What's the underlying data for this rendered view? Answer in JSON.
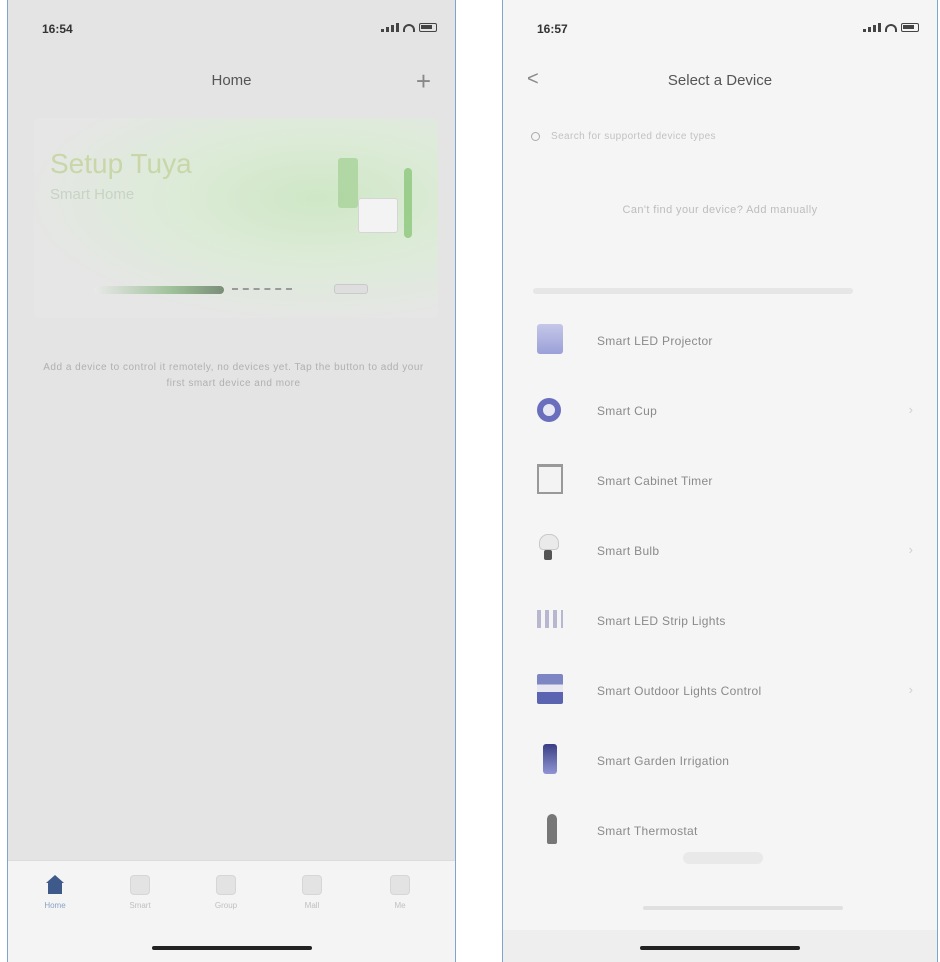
{
  "left": {
    "status": {
      "time": "16:54"
    },
    "header": {
      "title": "Home",
      "add_symbol": "+"
    },
    "banner": {
      "title": "Setup Tuya",
      "subtitle": "Smart Home"
    },
    "note": "Add a device to control it remotely, no devices yet. Tap the button to add your first smart device and more",
    "tabs": [
      {
        "label": "Home",
        "icon": "home-icon"
      },
      {
        "label": "Smart",
        "icon": "smart-icon"
      },
      {
        "label": "Group",
        "icon": "group-icon"
      },
      {
        "label": "Mall",
        "icon": "mall-icon"
      },
      {
        "label": "Me",
        "icon": "me-icon"
      }
    ]
  },
  "right": {
    "status": {
      "time": "16:57"
    },
    "header": {
      "title": "Select a Device",
      "back_symbol": "<"
    },
    "search": {
      "placeholder": "Search for supported device types"
    },
    "hint": "Can't find your device? Add manually",
    "devices": [
      {
        "name": "Smart LED Projector",
        "icon": "projector-icon"
      },
      {
        "name": "Smart Cup",
        "icon": "cup-icon"
      },
      {
        "name": "Smart Cabinet Timer",
        "icon": "cabinet-icon"
      },
      {
        "name": "Smart Bulb",
        "icon": "bulb-icon"
      },
      {
        "name": "Smart LED Strip Lights",
        "icon": "led-strip-icon"
      },
      {
        "name": "Smart Outdoor Lights Control",
        "icon": "outdoor-light-icon"
      },
      {
        "name": "Smart Garden Irrigation",
        "icon": "irrigation-icon"
      },
      {
        "name": "Smart Thermostat",
        "icon": "thermostat-icon"
      }
    ],
    "chevron": "›"
  },
  "colors": {
    "accent": "#3e5a8a",
    "frame": "#7aa6cf",
    "banner_green": "#cfe7c6"
  }
}
